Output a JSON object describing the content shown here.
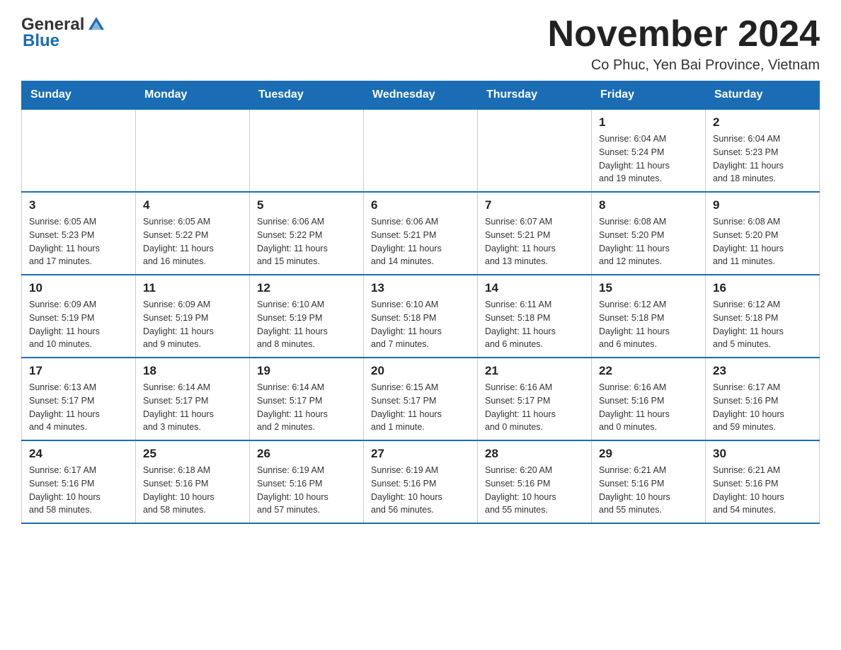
{
  "header": {
    "logo_general": "General",
    "logo_blue": "Blue",
    "month_title": "November 2024",
    "location": "Co Phuc, Yen Bai Province, Vietnam"
  },
  "weekdays": [
    "Sunday",
    "Monday",
    "Tuesday",
    "Wednesday",
    "Thursday",
    "Friday",
    "Saturday"
  ],
  "weeks": [
    [
      {
        "day": "",
        "info": ""
      },
      {
        "day": "",
        "info": ""
      },
      {
        "day": "",
        "info": ""
      },
      {
        "day": "",
        "info": ""
      },
      {
        "day": "",
        "info": ""
      },
      {
        "day": "1",
        "info": "Sunrise: 6:04 AM\nSunset: 5:24 PM\nDaylight: 11 hours\nand 19 minutes."
      },
      {
        "day": "2",
        "info": "Sunrise: 6:04 AM\nSunset: 5:23 PM\nDaylight: 11 hours\nand 18 minutes."
      }
    ],
    [
      {
        "day": "3",
        "info": "Sunrise: 6:05 AM\nSunset: 5:23 PM\nDaylight: 11 hours\nand 17 minutes."
      },
      {
        "day": "4",
        "info": "Sunrise: 6:05 AM\nSunset: 5:22 PM\nDaylight: 11 hours\nand 16 minutes."
      },
      {
        "day": "5",
        "info": "Sunrise: 6:06 AM\nSunset: 5:22 PM\nDaylight: 11 hours\nand 15 minutes."
      },
      {
        "day": "6",
        "info": "Sunrise: 6:06 AM\nSunset: 5:21 PM\nDaylight: 11 hours\nand 14 minutes."
      },
      {
        "day": "7",
        "info": "Sunrise: 6:07 AM\nSunset: 5:21 PM\nDaylight: 11 hours\nand 13 minutes."
      },
      {
        "day": "8",
        "info": "Sunrise: 6:08 AM\nSunset: 5:20 PM\nDaylight: 11 hours\nand 12 minutes."
      },
      {
        "day": "9",
        "info": "Sunrise: 6:08 AM\nSunset: 5:20 PM\nDaylight: 11 hours\nand 11 minutes."
      }
    ],
    [
      {
        "day": "10",
        "info": "Sunrise: 6:09 AM\nSunset: 5:19 PM\nDaylight: 11 hours\nand 10 minutes."
      },
      {
        "day": "11",
        "info": "Sunrise: 6:09 AM\nSunset: 5:19 PM\nDaylight: 11 hours\nand 9 minutes."
      },
      {
        "day": "12",
        "info": "Sunrise: 6:10 AM\nSunset: 5:19 PM\nDaylight: 11 hours\nand 8 minutes."
      },
      {
        "day": "13",
        "info": "Sunrise: 6:10 AM\nSunset: 5:18 PM\nDaylight: 11 hours\nand 7 minutes."
      },
      {
        "day": "14",
        "info": "Sunrise: 6:11 AM\nSunset: 5:18 PM\nDaylight: 11 hours\nand 6 minutes."
      },
      {
        "day": "15",
        "info": "Sunrise: 6:12 AM\nSunset: 5:18 PM\nDaylight: 11 hours\nand 6 minutes."
      },
      {
        "day": "16",
        "info": "Sunrise: 6:12 AM\nSunset: 5:18 PM\nDaylight: 11 hours\nand 5 minutes."
      }
    ],
    [
      {
        "day": "17",
        "info": "Sunrise: 6:13 AM\nSunset: 5:17 PM\nDaylight: 11 hours\nand 4 minutes."
      },
      {
        "day": "18",
        "info": "Sunrise: 6:14 AM\nSunset: 5:17 PM\nDaylight: 11 hours\nand 3 minutes."
      },
      {
        "day": "19",
        "info": "Sunrise: 6:14 AM\nSunset: 5:17 PM\nDaylight: 11 hours\nand 2 minutes."
      },
      {
        "day": "20",
        "info": "Sunrise: 6:15 AM\nSunset: 5:17 PM\nDaylight: 11 hours\nand 1 minute."
      },
      {
        "day": "21",
        "info": "Sunrise: 6:16 AM\nSunset: 5:17 PM\nDaylight: 11 hours\nand 0 minutes."
      },
      {
        "day": "22",
        "info": "Sunrise: 6:16 AM\nSunset: 5:16 PM\nDaylight: 11 hours\nand 0 minutes."
      },
      {
        "day": "23",
        "info": "Sunrise: 6:17 AM\nSunset: 5:16 PM\nDaylight: 10 hours\nand 59 minutes."
      }
    ],
    [
      {
        "day": "24",
        "info": "Sunrise: 6:17 AM\nSunset: 5:16 PM\nDaylight: 10 hours\nand 58 minutes."
      },
      {
        "day": "25",
        "info": "Sunrise: 6:18 AM\nSunset: 5:16 PM\nDaylight: 10 hours\nand 58 minutes."
      },
      {
        "day": "26",
        "info": "Sunrise: 6:19 AM\nSunset: 5:16 PM\nDaylight: 10 hours\nand 57 minutes."
      },
      {
        "day": "27",
        "info": "Sunrise: 6:19 AM\nSunset: 5:16 PM\nDaylight: 10 hours\nand 56 minutes."
      },
      {
        "day": "28",
        "info": "Sunrise: 6:20 AM\nSunset: 5:16 PM\nDaylight: 10 hours\nand 55 minutes."
      },
      {
        "day": "29",
        "info": "Sunrise: 6:21 AM\nSunset: 5:16 PM\nDaylight: 10 hours\nand 55 minutes."
      },
      {
        "day": "30",
        "info": "Sunrise: 6:21 AM\nSunset: 5:16 PM\nDaylight: 10 hours\nand 54 minutes."
      }
    ]
  ]
}
